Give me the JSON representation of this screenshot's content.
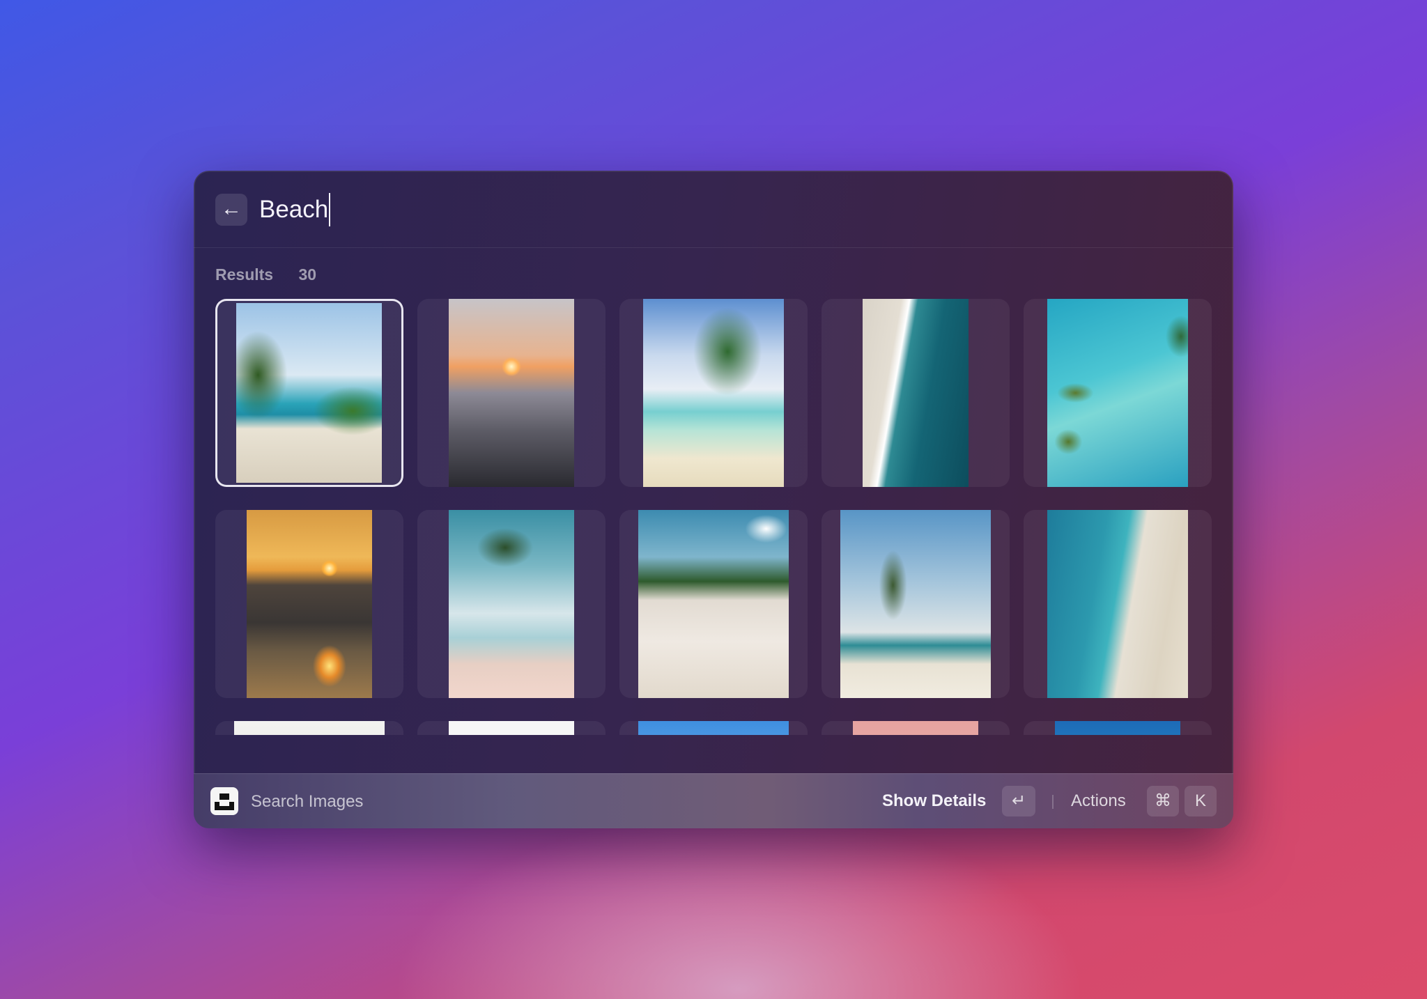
{
  "search": {
    "query": "Beach",
    "back_icon": "arrow-left-icon"
  },
  "results": {
    "label": "Results",
    "count": "30",
    "items": [
      {
        "subject": "palm trees framing tropical beach",
        "selected": true
      },
      {
        "subject": "sunset over wet sand"
      },
      {
        "subject": "leaning palm over turquoise water"
      },
      {
        "subject": "aerial shoreline with waves"
      },
      {
        "subject": "aerial lagoon with islands"
      },
      {
        "subject": "golden sunset over sea"
      },
      {
        "subject": "tall palm on beach"
      },
      {
        "subject": "white sand beach with clouds"
      },
      {
        "subject": "palm trees and person on beach"
      },
      {
        "subject": "aerial crowded beach"
      },
      {
        "subject": "palm tree against pale sky"
      },
      {
        "subject": "white sky"
      },
      {
        "subject": "blue sky with palm fronds"
      },
      {
        "subject": "pink sky"
      },
      {
        "subject": "aerial turquoise coast"
      }
    ]
  },
  "footer": {
    "app_icon": "unsplash-logo-icon",
    "title": "Search Images",
    "primary_action": "Show Details",
    "primary_key": "↵",
    "secondary_action": "Actions",
    "secondary_keys": [
      "⌘",
      "K"
    ]
  },
  "colors": {
    "window_bg": "#2b2452",
    "selection_ring": "#e8e6f0",
    "text_primary": "#f4f2fa"
  }
}
